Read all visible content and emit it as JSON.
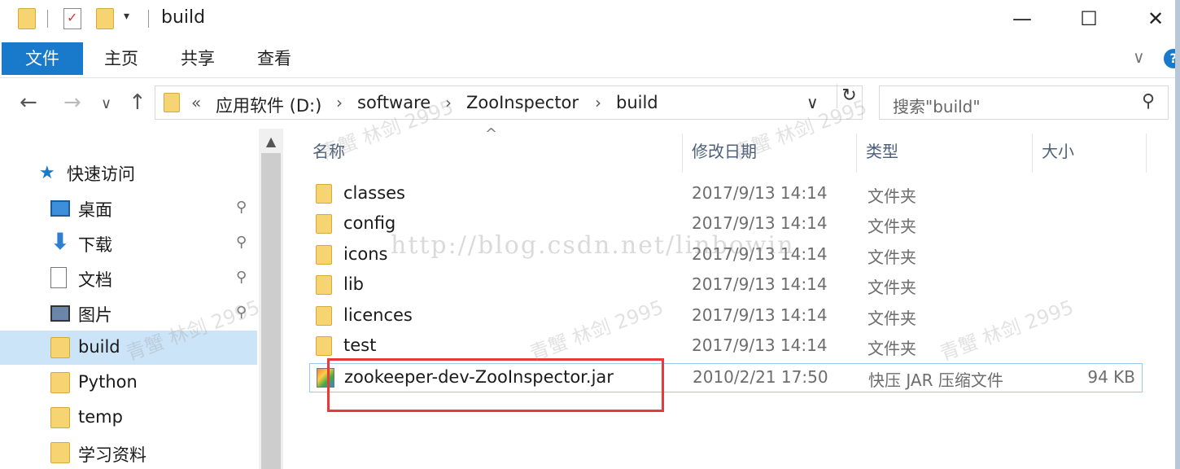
{
  "window": {
    "title": "build",
    "minimize_glyph": "—",
    "maximize_glyph": "☐",
    "close_glyph": "✕",
    "qat_dropdown_glyph": "▾"
  },
  "ribbon": {
    "tabs": [
      "文件",
      "主页",
      "共享",
      "查看"
    ],
    "collapse_glyph": "∨",
    "help_glyph": "?"
  },
  "navigation": {
    "back_glyph": "←",
    "forward_glyph": "→",
    "recent_glyph": "∨",
    "up_glyph": "↑",
    "breadcrumb_overflow": "«",
    "breadcrumb": [
      "应用软件 (D:)",
      "software",
      "ZooInspector",
      "build"
    ],
    "breadcrumb_sep": "›",
    "dropdown_glyph": "∨",
    "refresh_glyph": "↻",
    "search_placeholder": "搜索\"build\"",
    "search_glyph": "⚲"
  },
  "sidebar": {
    "quick_access_label": "快速访问",
    "items": [
      {
        "label": "桌面",
        "icon": "desktop-icon",
        "pinned": true
      },
      {
        "label": "下载",
        "icon": "download-icon",
        "pinned": true
      },
      {
        "label": "文档",
        "icon": "document-icon",
        "pinned": true
      },
      {
        "label": "图片",
        "icon": "pictures-icon",
        "pinned": true
      },
      {
        "label": "build",
        "icon": "folder-icon",
        "pinned": false,
        "selected": true
      },
      {
        "label": "Python",
        "icon": "folder-icon",
        "pinned": false
      },
      {
        "label": "temp",
        "icon": "folder-icon",
        "pinned": false
      },
      {
        "label": "学习资料",
        "icon": "folder-icon",
        "pinned": false
      }
    ],
    "pin_glyph": "📌",
    "scroll_up_glyph": "▲"
  },
  "file_list": {
    "sort_glyph": "^",
    "columns": {
      "name": "名称",
      "modified": "修改日期",
      "type": "类型",
      "size": "大小"
    },
    "rows": [
      {
        "name": "classes",
        "modified": "2017/9/13 14:14",
        "type": "文件夹",
        "size": "",
        "kind": "folder"
      },
      {
        "name": "config",
        "modified": "2017/9/13 14:14",
        "type": "文件夹",
        "size": "",
        "kind": "folder"
      },
      {
        "name": "icons",
        "modified": "2017/9/13 14:14",
        "type": "文件夹",
        "size": "",
        "kind": "folder"
      },
      {
        "name": "lib",
        "modified": "2017/9/13 14:14",
        "type": "文件夹",
        "size": "",
        "kind": "folder"
      },
      {
        "name": "licences",
        "modified": "2017/9/13 14:14",
        "type": "文件夹",
        "size": "",
        "kind": "folder"
      },
      {
        "name": "test",
        "modified": "2017/9/13 14:14",
        "type": "文件夹",
        "size": "",
        "kind": "folder"
      },
      {
        "name": "zookeeper-dev-ZooInspector.jar",
        "modified": "2010/2/21 17:50",
        "type": "快压 JAR 压缩文件",
        "size": "94 KB",
        "kind": "jar"
      }
    ]
  },
  "watermarks": {
    "url": "http://blog.csdn.net/linbowin",
    "tag": "青蟹 林剑 2995"
  },
  "colors": {
    "accent": "#1979ca",
    "selection": "#cce4f7",
    "highlight_box": "#e8393b"
  }
}
